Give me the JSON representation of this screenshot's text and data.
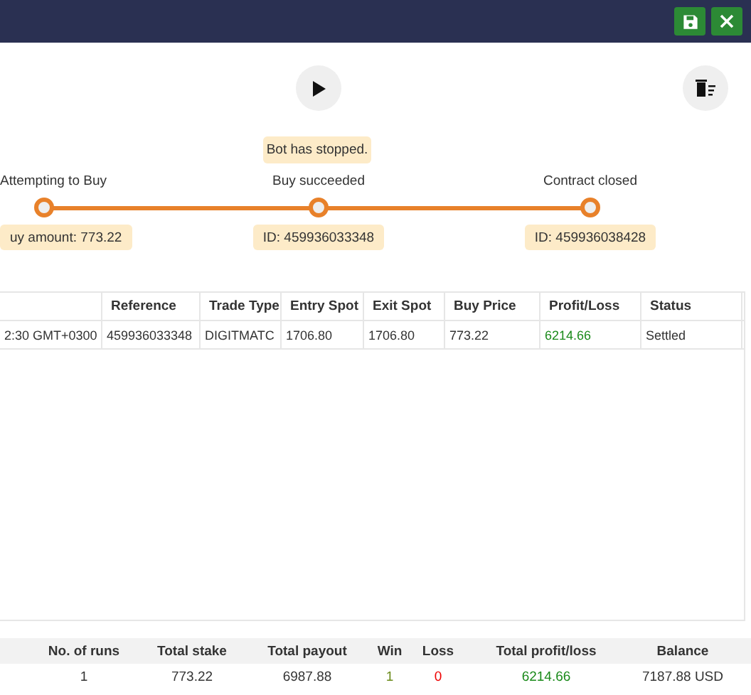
{
  "header": {
    "buttons": [
      {
        "kind": "save"
      },
      {
        "kind": "close"
      }
    ]
  },
  "controls": {
    "run": {
      "kind": "play"
    },
    "clear": {
      "kind": "clear"
    }
  },
  "status_message": "Bot has stopped.",
  "steps": [
    {
      "label": "Attempting to Buy",
      "detail": "uy amount: 773.22",
      "done": false
    },
    {
      "label": "Buy succeeded",
      "detail": "ID: 459936033348",
      "done": false
    },
    {
      "label": "Contract closed",
      "detail": "ID: 459936038428",
      "done": false
    }
  ],
  "table": {
    "columns": [
      "",
      "Reference",
      "Trade Type",
      "Entry Spot",
      "Exit Spot",
      "Buy Price",
      "Profit/Loss",
      "Status"
    ],
    "rows": [
      {
        "cells": [
          "2:30 GMT+0300",
          "459936033348",
          "DIGITMATC",
          "1706.80",
          "1706.80",
          "773.22",
          "6214.66",
          "Settled"
        ],
        "profit": true
      }
    ]
  },
  "summary": {
    "columns": [
      "No. of runs",
      "Total stake",
      "Total payout",
      "Win",
      "Loss",
      "Total profit/loss",
      "Balance"
    ],
    "values": [
      "1",
      "773.22",
      "6987.88",
      "1",
      "0",
      "6214.66",
      "7187.88 USD"
    ]
  }
}
